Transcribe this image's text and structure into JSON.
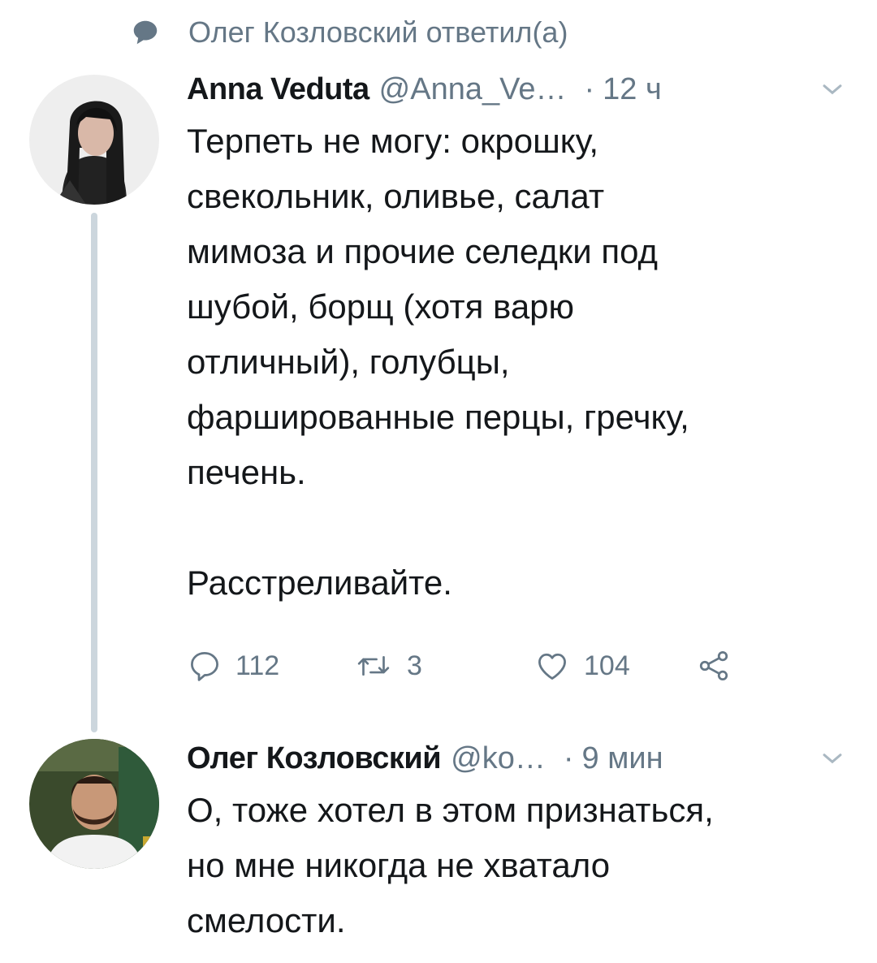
{
  "context": {
    "text": "Олег Козловский ответил(а)",
    "icon": "reply-bubble-icon"
  },
  "tweets": [
    {
      "name": "Anna Veduta",
      "handle": "@Anna_Ve…",
      "separator": "·",
      "time": "12 ч",
      "paragraphs": [
        "Терпеть не могу: окрошку, свекольник, оливье, салат мимоза и прочие селедки под шубой, борщ (хотя варю отличный), голубцы, фаршированные перцы, гречку, печень.",
        "Расстреливайте."
      ],
      "lines": [
        "Терпеть не могу: окрошку,",
        "свекольник, оливье, салат",
        "мимоза и прочие селедки под",
        "шубой, борщ (хотя варю",
        "отличный), голубцы,",
        "фаршированные перцы, гречку,",
        "печень.",
        "",
        "Расстреливайте."
      ],
      "actions": {
        "replies": "112",
        "retweets": "3",
        "likes": "104"
      }
    },
    {
      "name": "Олег Козловский",
      "handle": "@ko…",
      "separator": "·",
      "time": "9 мин",
      "lines": [
        "О, тоже хотел в этом признаться,",
        "но мне никогда не хватало",
        "смелости."
      ]
    }
  ],
  "colors": {
    "text": "#14171a",
    "secondary": "#657786",
    "thread_line": "#ccd6dd"
  }
}
